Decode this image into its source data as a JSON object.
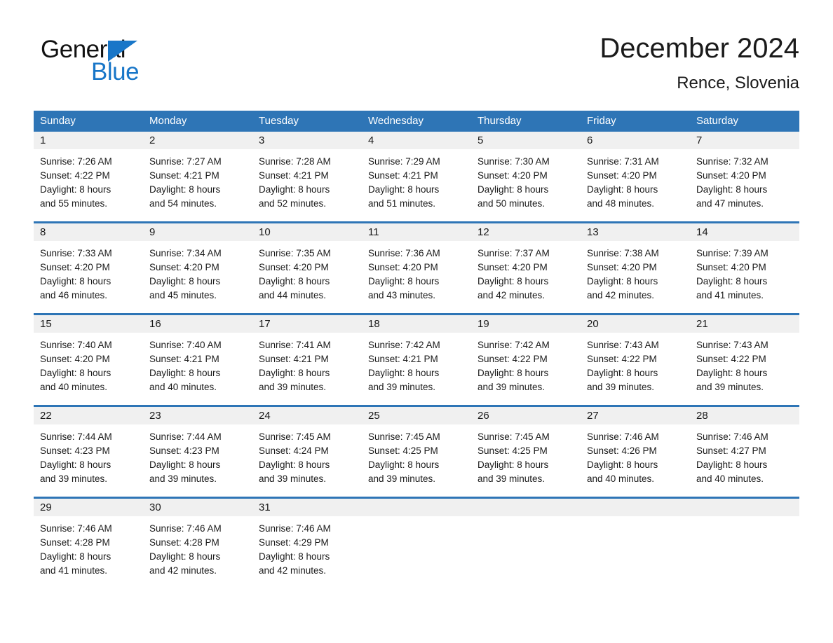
{
  "brand": {
    "name_part1": "General",
    "name_part2": "Blue",
    "accent_color": "#1876c8"
  },
  "header": {
    "title": "December 2024",
    "subtitle": "Rence, Slovenia"
  },
  "theme": {
    "header_blue": "#2e75b6",
    "date_band": "#f0f0f0",
    "text": "#1a1a1a"
  },
  "weekdays": [
    "Sunday",
    "Monday",
    "Tuesday",
    "Wednesday",
    "Thursday",
    "Friday",
    "Saturday"
  ],
  "weeks": [
    {
      "days": [
        {
          "date": "1",
          "sunrise": "Sunrise: 7:26 AM",
          "sunset": "Sunset: 4:22 PM",
          "daylight_1": "Daylight: 8 hours",
          "daylight_2": "and 55 minutes."
        },
        {
          "date": "2",
          "sunrise": "Sunrise: 7:27 AM",
          "sunset": "Sunset: 4:21 PM",
          "daylight_1": "Daylight: 8 hours",
          "daylight_2": "and 54 minutes."
        },
        {
          "date": "3",
          "sunrise": "Sunrise: 7:28 AM",
          "sunset": "Sunset: 4:21 PM",
          "daylight_1": "Daylight: 8 hours",
          "daylight_2": "and 52 minutes."
        },
        {
          "date": "4",
          "sunrise": "Sunrise: 7:29 AM",
          "sunset": "Sunset: 4:21 PM",
          "daylight_1": "Daylight: 8 hours",
          "daylight_2": "and 51 minutes."
        },
        {
          "date": "5",
          "sunrise": "Sunrise: 7:30 AM",
          "sunset": "Sunset: 4:20 PM",
          "daylight_1": "Daylight: 8 hours",
          "daylight_2": "and 50 minutes."
        },
        {
          "date": "6",
          "sunrise": "Sunrise: 7:31 AM",
          "sunset": "Sunset: 4:20 PM",
          "daylight_1": "Daylight: 8 hours",
          "daylight_2": "and 48 minutes."
        },
        {
          "date": "7",
          "sunrise": "Sunrise: 7:32 AM",
          "sunset": "Sunset: 4:20 PM",
          "daylight_1": "Daylight: 8 hours",
          "daylight_2": "and 47 minutes."
        }
      ]
    },
    {
      "days": [
        {
          "date": "8",
          "sunrise": "Sunrise: 7:33 AM",
          "sunset": "Sunset: 4:20 PM",
          "daylight_1": "Daylight: 8 hours",
          "daylight_2": "and 46 minutes."
        },
        {
          "date": "9",
          "sunrise": "Sunrise: 7:34 AM",
          "sunset": "Sunset: 4:20 PM",
          "daylight_1": "Daylight: 8 hours",
          "daylight_2": "and 45 minutes."
        },
        {
          "date": "10",
          "sunrise": "Sunrise: 7:35 AM",
          "sunset": "Sunset: 4:20 PM",
          "daylight_1": "Daylight: 8 hours",
          "daylight_2": "and 44 minutes."
        },
        {
          "date": "11",
          "sunrise": "Sunrise: 7:36 AM",
          "sunset": "Sunset: 4:20 PM",
          "daylight_1": "Daylight: 8 hours",
          "daylight_2": "and 43 minutes."
        },
        {
          "date": "12",
          "sunrise": "Sunrise: 7:37 AM",
          "sunset": "Sunset: 4:20 PM",
          "daylight_1": "Daylight: 8 hours",
          "daylight_2": "and 42 minutes."
        },
        {
          "date": "13",
          "sunrise": "Sunrise: 7:38 AM",
          "sunset": "Sunset: 4:20 PM",
          "daylight_1": "Daylight: 8 hours",
          "daylight_2": "and 42 minutes."
        },
        {
          "date": "14",
          "sunrise": "Sunrise: 7:39 AM",
          "sunset": "Sunset: 4:20 PM",
          "daylight_1": "Daylight: 8 hours",
          "daylight_2": "and 41 minutes."
        }
      ]
    },
    {
      "days": [
        {
          "date": "15",
          "sunrise": "Sunrise: 7:40 AM",
          "sunset": "Sunset: 4:20 PM",
          "daylight_1": "Daylight: 8 hours",
          "daylight_2": "and 40 minutes."
        },
        {
          "date": "16",
          "sunrise": "Sunrise: 7:40 AM",
          "sunset": "Sunset: 4:21 PM",
          "daylight_1": "Daylight: 8 hours",
          "daylight_2": "and 40 minutes."
        },
        {
          "date": "17",
          "sunrise": "Sunrise: 7:41 AM",
          "sunset": "Sunset: 4:21 PM",
          "daylight_1": "Daylight: 8 hours",
          "daylight_2": "and 39 minutes."
        },
        {
          "date": "18",
          "sunrise": "Sunrise: 7:42 AM",
          "sunset": "Sunset: 4:21 PM",
          "daylight_1": "Daylight: 8 hours",
          "daylight_2": "and 39 minutes."
        },
        {
          "date": "19",
          "sunrise": "Sunrise: 7:42 AM",
          "sunset": "Sunset: 4:22 PM",
          "daylight_1": "Daylight: 8 hours",
          "daylight_2": "and 39 minutes."
        },
        {
          "date": "20",
          "sunrise": "Sunrise: 7:43 AM",
          "sunset": "Sunset: 4:22 PM",
          "daylight_1": "Daylight: 8 hours",
          "daylight_2": "and 39 minutes."
        },
        {
          "date": "21",
          "sunrise": "Sunrise: 7:43 AM",
          "sunset": "Sunset: 4:22 PM",
          "daylight_1": "Daylight: 8 hours",
          "daylight_2": "and 39 minutes."
        }
      ]
    },
    {
      "days": [
        {
          "date": "22",
          "sunrise": "Sunrise: 7:44 AM",
          "sunset": "Sunset: 4:23 PM",
          "daylight_1": "Daylight: 8 hours",
          "daylight_2": "and 39 minutes."
        },
        {
          "date": "23",
          "sunrise": "Sunrise: 7:44 AM",
          "sunset": "Sunset: 4:23 PM",
          "daylight_1": "Daylight: 8 hours",
          "daylight_2": "and 39 minutes."
        },
        {
          "date": "24",
          "sunrise": "Sunrise: 7:45 AM",
          "sunset": "Sunset: 4:24 PM",
          "daylight_1": "Daylight: 8 hours",
          "daylight_2": "and 39 minutes."
        },
        {
          "date": "25",
          "sunrise": "Sunrise: 7:45 AM",
          "sunset": "Sunset: 4:25 PM",
          "daylight_1": "Daylight: 8 hours",
          "daylight_2": "and 39 minutes."
        },
        {
          "date": "26",
          "sunrise": "Sunrise: 7:45 AM",
          "sunset": "Sunset: 4:25 PM",
          "daylight_1": "Daylight: 8 hours",
          "daylight_2": "and 39 minutes."
        },
        {
          "date": "27",
          "sunrise": "Sunrise: 7:46 AM",
          "sunset": "Sunset: 4:26 PM",
          "daylight_1": "Daylight: 8 hours",
          "daylight_2": "and 40 minutes."
        },
        {
          "date": "28",
          "sunrise": "Sunrise: 7:46 AM",
          "sunset": "Sunset: 4:27 PM",
          "daylight_1": "Daylight: 8 hours",
          "daylight_2": "and 40 minutes."
        }
      ]
    },
    {
      "days": [
        {
          "date": "29",
          "sunrise": "Sunrise: 7:46 AM",
          "sunset": "Sunset: 4:28 PM",
          "daylight_1": "Daylight: 8 hours",
          "daylight_2": "and 41 minutes."
        },
        {
          "date": "30",
          "sunrise": "Sunrise: 7:46 AM",
          "sunset": "Sunset: 4:28 PM",
          "daylight_1": "Daylight: 8 hours",
          "daylight_2": "and 42 minutes."
        },
        {
          "date": "31",
          "sunrise": "Sunrise: 7:46 AM",
          "sunset": "Sunset: 4:29 PM",
          "daylight_1": "Daylight: 8 hours",
          "daylight_2": "and 42 minutes."
        },
        {
          "date": "",
          "sunrise": "",
          "sunset": "",
          "daylight_1": "",
          "daylight_2": ""
        },
        {
          "date": "",
          "sunrise": "",
          "sunset": "",
          "daylight_1": "",
          "daylight_2": ""
        },
        {
          "date": "",
          "sunrise": "",
          "sunset": "",
          "daylight_1": "",
          "daylight_2": ""
        },
        {
          "date": "",
          "sunrise": "",
          "sunset": "",
          "daylight_1": "",
          "daylight_2": ""
        }
      ]
    }
  ]
}
